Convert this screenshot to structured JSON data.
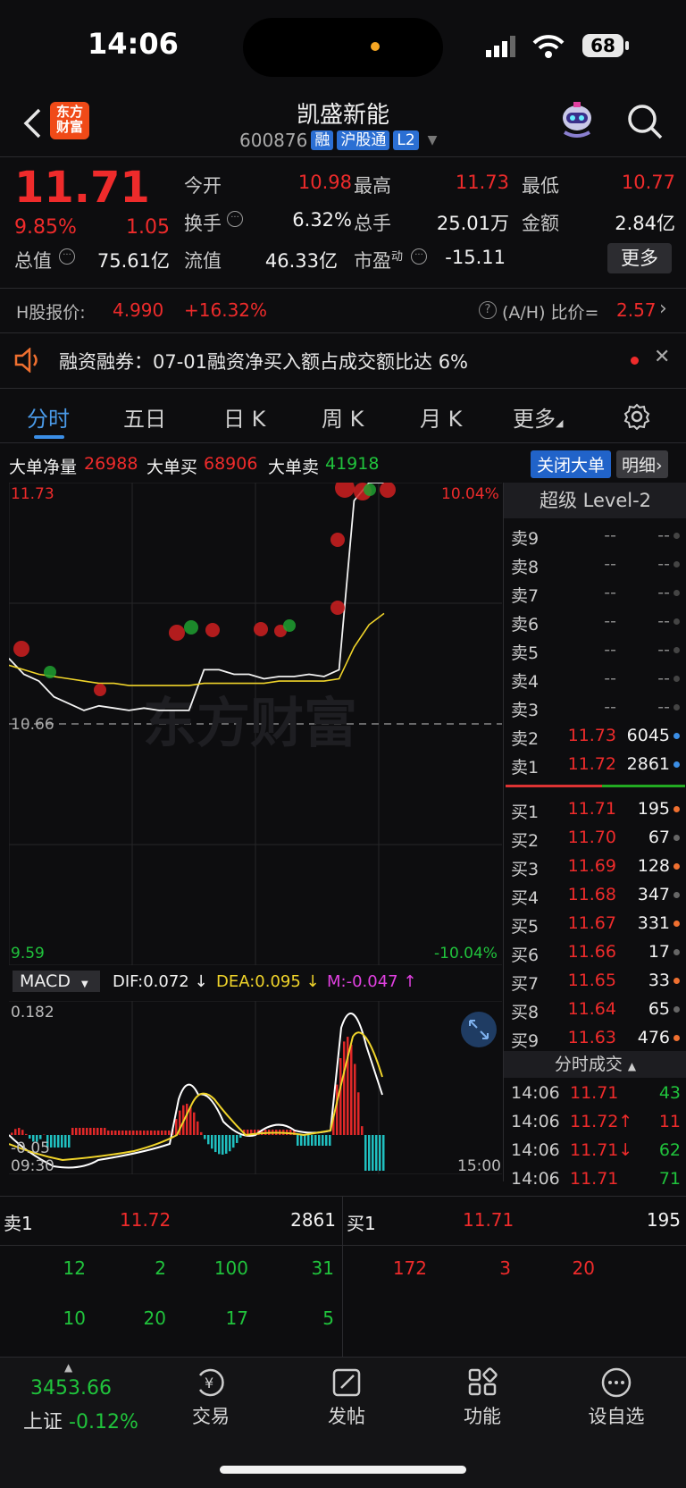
{
  "status": {
    "time": "14:06",
    "battery": "68"
  },
  "header": {
    "name": "凯盛新能",
    "code": "600876",
    "tags": [
      "融",
      "沪股通",
      "L2"
    ],
    "logo": [
      "东方",
      "财富"
    ]
  },
  "quote": {
    "price": "11.71",
    "pct": "9.85%",
    "change": "1.05",
    "open_label": "今开",
    "open": "10.98",
    "high_label": "最高",
    "high": "11.73",
    "low_label": "最低",
    "low": "10.77",
    "turnover_label": "换手",
    "turnover": "6.32%",
    "volume_label": "总手",
    "volume": "25.01万",
    "amount_label": "金额",
    "amount": "2.84亿",
    "mktcap_label": "总值",
    "mktcap": "75.61亿",
    "float_label": "流值",
    "float": "46.33亿",
    "pe_label": "市盈",
    "pe_sup": "动",
    "pe": "-15.11",
    "more": "更多"
  },
  "hshare": {
    "label": "H股报价:",
    "price": "4.990",
    "premium": "+16.32%",
    "ah_label": "(A/H) 比价=",
    "ah": "2.57"
  },
  "notice": {
    "text": "融资融券：07-01融资净买入额占成交额比达 6%"
  },
  "tabs": [
    "分时",
    "五日",
    "日 K",
    "周 K",
    "月 K",
    "更多"
  ],
  "bigorder": {
    "net_label": "大单净量",
    "net": "26988",
    "buy_label": "大单买",
    "buy": "68906",
    "sell_label": "大单卖",
    "sell": "41918",
    "close_btn": "关闭大单",
    "detail_btn": "明细"
  },
  "chart": {
    "top_price": "11.73",
    "top_pct": "10.04%",
    "mid_price": "10.66",
    "bot_price": "9.59",
    "bot_pct": "-10.04%",
    "watermark": "东方财富",
    "time_start": "09:30",
    "time_end": "15:00",
    "macd_name": "MACD",
    "dif": "DIF:0.072 ↓",
    "dea": "DEA:0.095 ↓",
    "m": "M:-0.047 ↑",
    "macd_top": "0.182",
    "macd_bot": "-0.05"
  },
  "chart_data": {
    "type": "line",
    "title": "",
    "xlabel": "",
    "ylabel": "",
    "x_range": [
      "09:30",
      "15:00"
    ],
    "ylim": [
      9.59,
      11.73
    ],
    "prev_close": 10.66,
    "series": [
      {
        "values": [
          10.95,
          10.88,
          10.85,
          10.78,
          10.75,
          10.72,
          10.74,
          10.73,
          10.72,
          10.73,
          10.72,
          10.72,
          10.72,
          10.9,
          10.9,
          10.88,
          10.88,
          10.86,
          10.87,
          10.87,
          10.88,
          10.87,
          10.9,
          11.65,
          11.73,
          11.73
        ]
      },
      {
        "values": [
          10.92,
          10.9,
          10.88,
          10.87,
          10.86,
          10.85,
          10.84,
          10.84,
          10.83,
          10.83,
          10.83,
          10.83,
          10.83,
          10.84,
          10.84,
          10.84,
          10.84,
          10.84,
          10.85,
          10.85,
          10.85,
          10.85,
          10.86,
          11.0,
          11.1,
          11.15
        ]
      }
    ]
  },
  "level2": {
    "title": "超级 Level-2",
    "asks": [
      {
        "label": "卖9",
        "price": "--",
        "vol": "--"
      },
      {
        "label": "卖8",
        "price": "--",
        "vol": "--"
      },
      {
        "label": "卖7",
        "price": "--",
        "vol": "--"
      },
      {
        "label": "卖6",
        "price": "--",
        "vol": "--"
      },
      {
        "label": "卖5",
        "price": "--",
        "vol": "--"
      },
      {
        "label": "卖4",
        "price": "--",
        "vol": "--"
      },
      {
        "label": "卖3",
        "price": "--",
        "vol": "--"
      },
      {
        "label": "卖2",
        "price": "11.73",
        "vol": "6045"
      },
      {
        "label": "卖1",
        "price": "11.72",
        "vol": "2861"
      }
    ],
    "bids": [
      {
        "label": "买1",
        "price": "11.71",
        "vol": "195"
      },
      {
        "label": "买2",
        "price": "11.70",
        "vol": "67"
      },
      {
        "label": "买3",
        "price": "11.69",
        "vol": "128"
      },
      {
        "label": "买4",
        "price": "11.68",
        "vol": "347"
      },
      {
        "label": "买5",
        "price": "11.67",
        "vol": "331"
      },
      {
        "label": "买6",
        "price": "11.66",
        "vol": "17"
      },
      {
        "label": "买7",
        "price": "11.65",
        "vol": "33"
      },
      {
        "label": "买8",
        "price": "11.64",
        "vol": "65"
      },
      {
        "label": "买9",
        "price": "11.63",
        "vol": "476"
      }
    ],
    "trades_title": "分时成交",
    "trades": [
      {
        "time": "14:06",
        "price": "11.71",
        "vol": "43"
      },
      {
        "time": "14:06",
        "price": "11.72↑",
        "vol": "11"
      },
      {
        "time": "14:06",
        "price": "11.71↓",
        "vol": "62"
      },
      {
        "time": "14:06",
        "price": "11.71",
        "vol": "71"
      }
    ]
  },
  "queue": {
    "ask_label": "卖1",
    "ask_price": "11.72",
    "ask_vol": "2861",
    "bid_label": "买1",
    "bid_price": "11.71",
    "bid_vol": "195",
    "ask_orders": [
      "12",
      "2",
      "100",
      "31",
      "10",
      "20",
      "17",
      "5"
    ],
    "bid_orders": [
      "172",
      "3",
      "20"
    ]
  },
  "nav": {
    "index_value": "3453.66",
    "index_name": "上证",
    "index_pct": "-0.12%",
    "items": [
      "交易",
      "发帖",
      "功能",
      "设自选"
    ]
  }
}
